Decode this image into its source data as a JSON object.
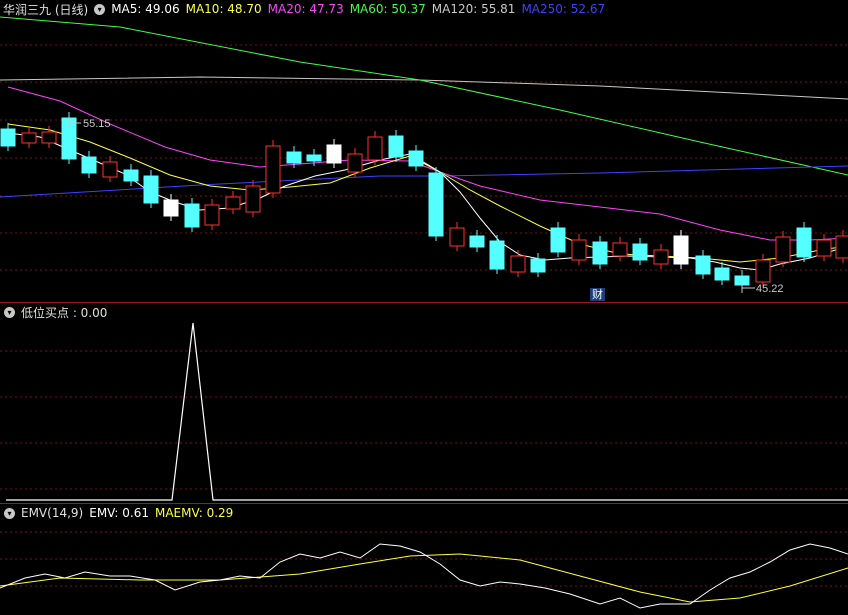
{
  "main": {
    "title": "华润三九 (日线)",
    "ma": [
      {
        "label": "MA5: 49.06",
        "color": "#ffffff"
      },
      {
        "label": "MA10: 48.70",
        "color": "#ffff40"
      },
      {
        "label": "MA20: 47.73",
        "color": "#ff40ff"
      },
      {
        "label": "MA60: 50.37",
        "color": "#40ff40"
      },
      {
        "label": "MA120: 55.81",
        "color": "#c8c8c8"
      },
      {
        "label": "MA250: 52.67",
        "color": "#4040ff"
      }
    ],
    "high_mark": "55.15",
    "low_mark": "45.22",
    "badge": "财"
  },
  "ind1": {
    "label": "低位买点 : 0.00"
  },
  "ind2": {
    "title": "EMV(14,9)",
    "emv_label": "EMV: 0.61",
    "maemv_label": "MAEMV: 0.29"
  },
  "colors": {
    "up": "#ff3030",
    "down": "#54ffff",
    "grid": "#7a1010",
    "border": "#9a1a1a"
  }
}
